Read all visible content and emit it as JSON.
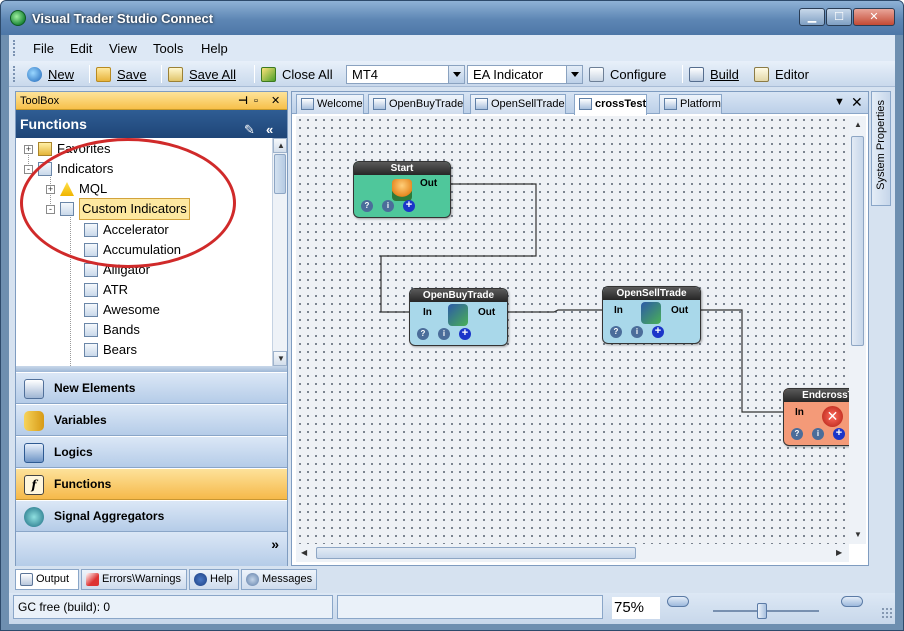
{
  "window": {
    "title": "Visual Trader Studio Connect"
  },
  "menu": [
    "File",
    "Edit",
    "View",
    "Tools",
    "Help"
  ],
  "toolbar": {
    "new_label": "New",
    "save_label": "Save",
    "save_all_label": "Save All",
    "close_all_label": "Close All",
    "platform_select": "MT4",
    "type_select": "EA Indicator",
    "configure_label": "Configure",
    "build_label": "Build",
    "editor_label": "Editor"
  },
  "toolbox": {
    "title": "ToolBox",
    "header": "Functions",
    "tree": [
      {
        "label": "Favorites",
        "level": 0,
        "expander": "+"
      },
      {
        "label": "Indicators",
        "level": 0,
        "expander": "-"
      },
      {
        "label": "MQL",
        "level": 1,
        "expander": "+"
      },
      {
        "label": "Custom Indicators",
        "level": 1,
        "expander": "-"
      },
      {
        "label": "Accelerator",
        "level": 2
      },
      {
        "label": "Accumulation",
        "level": 2
      },
      {
        "label": "Alligator",
        "level": 2
      },
      {
        "label": "ATR",
        "level": 2
      },
      {
        "label": "Awesome",
        "level": 2
      },
      {
        "label": "Bands",
        "level": 2
      },
      {
        "label": "Bears",
        "level": 2
      }
    ],
    "categories": [
      "New Elements",
      "Variables",
      "Logics",
      "Functions",
      "Signal Aggregators"
    ],
    "active_category": "Functions"
  },
  "tabs": [
    "Welcome",
    "OpenBuyTrade",
    "OpenSellTrade",
    "crossTest",
    "Platform"
  ],
  "active_tab": "crossTest",
  "nodes": {
    "start": {
      "title": "Start",
      "out": "Out"
    },
    "open_buy": {
      "title": "OpenBuyTrade",
      "in": "In",
      "out": "Out"
    },
    "open_sell": {
      "title": "OpenSellTrade",
      "in": "In",
      "out": "Out"
    },
    "end": {
      "title": "EndcrossT",
      "in": "In"
    }
  },
  "right_panel": {
    "system_properties": "System Properties"
  },
  "bottom_tabs": [
    "Output",
    "Errors\\Warnings",
    "Help",
    "Messages"
  ],
  "status": {
    "left": "GC free (build): 0",
    "zoom": "75%"
  },
  "colors": {
    "start_node": "#4fc79b",
    "trade_node": "#a9d8ea",
    "end_node": "#f49a78",
    "active_category": "#f6b94a"
  }
}
